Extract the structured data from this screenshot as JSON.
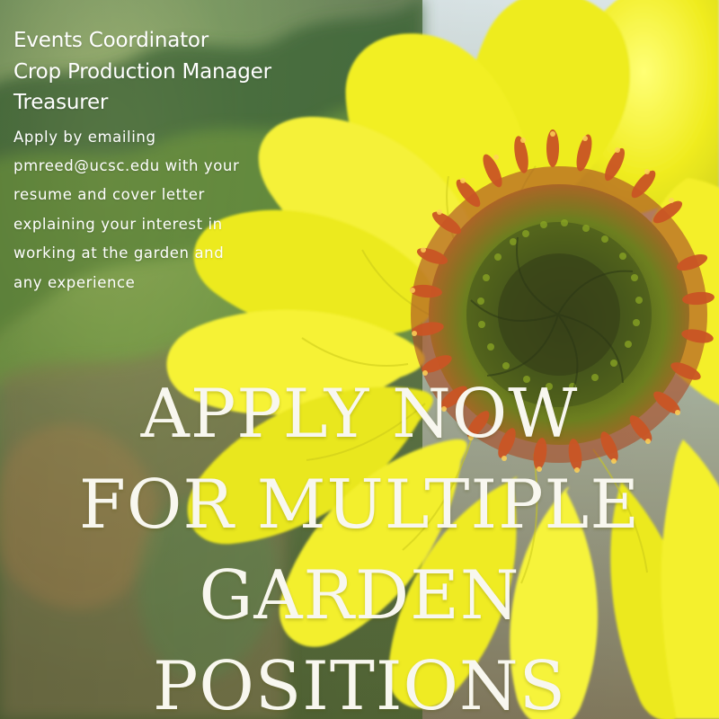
{
  "poster": {
    "positions": [
      "Events Coordinator",
      "Crop Production Manager",
      "Treasurer"
    ],
    "apply_instructions": "Apply by emailing pmreed@ucsc.edu with your resume and cover letter explaining your interest in working at the garden and any experience",
    "headline_lines": [
      "APPLY NOW",
      "FOR MULTIPLE",
      "GARDEN",
      "POSITIONS"
    ]
  },
  "colors": {
    "petal": "#ece918",
    "petal_light": "#f8f64a",
    "center_dark": "#314516",
    "center_ring": "#b64920",
    "foliage": "#5f8e31",
    "sky": "#c8d7cf",
    "text": "#ffffff"
  }
}
